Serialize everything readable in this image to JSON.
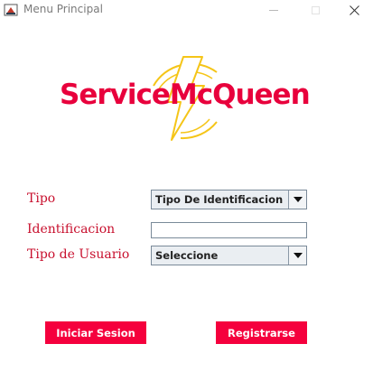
{
  "window": {
    "title": "Menu Principal"
  },
  "logo": {
    "text": "ServiceMcQueen",
    "colors": {
      "text": "#e8003c",
      "bolt": "#f5c518"
    }
  },
  "form": {
    "tipo_label": "Tipo",
    "tipo_select": {
      "selected": "Tipo De Identificacion"
    },
    "identificacion_label": "Identificacion",
    "identificacion_input": {
      "value": ""
    },
    "tipo_usuario_label": "Tipo de Usuario",
    "tipo_usuario_select": {
      "selected": "Seleccione"
    }
  },
  "actions": {
    "login_label": "Iniciar Sesion",
    "register_label": "Registrarse"
  },
  "colors": {
    "accent": "#f5003d",
    "label_text": "#c8102e"
  },
  "icons": {
    "app": "java-cup-icon",
    "minimize": "minimize-icon",
    "maximize": "maximize-icon",
    "close": "close-icon",
    "dropdown": "chevron-down-icon",
    "logo": "lightning-bolt-icon"
  }
}
